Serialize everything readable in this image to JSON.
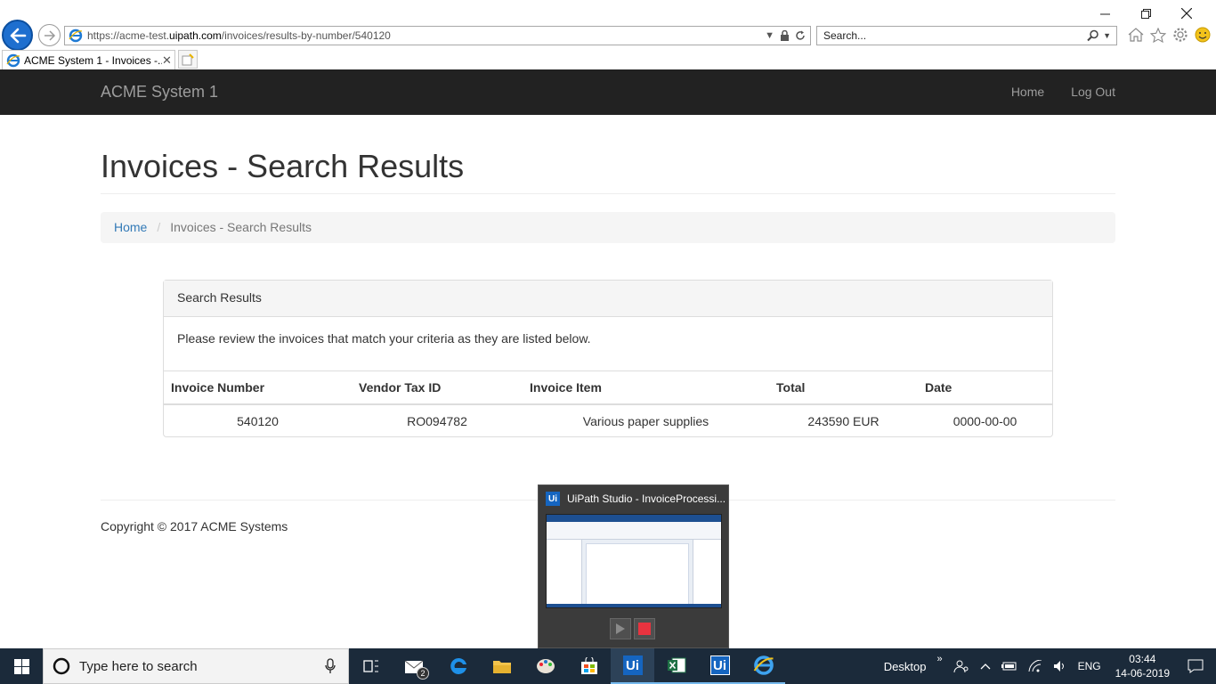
{
  "browser": {
    "url_prefix": "https://acme-test.",
    "url_host": "uipath.com",
    "url_path": "/invoices/results-by-number/540120",
    "search_placeholder": "Search...",
    "tab_title": "ACME System 1 - Invoices -...",
    "tab_close": "✕"
  },
  "navbar": {
    "brand": "ACME System 1",
    "links": [
      "Home",
      "Log Out"
    ]
  },
  "page": {
    "title": "Invoices - Search Results",
    "breadcrumb": {
      "home": "Home",
      "separator": "/",
      "current": "Invoices - Search Results"
    },
    "panel": {
      "heading": "Search Results",
      "body": "Please review the invoices that match your criteria as they are listed below.",
      "columns": [
        "Invoice Number",
        "Vendor Tax ID",
        "Invoice Item",
        "Total",
        "Date"
      ],
      "rows": [
        [
          "540120",
          "RO094782",
          "Various paper supplies",
          "243590 EUR",
          "0000-00-00"
        ]
      ]
    },
    "footer": "Copyright © 2017 ACME Systems"
  },
  "preview": {
    "title": "UiPath Studio - InvoiceProcessi...",
    "logo": "Ui"
  },
  "taskbar": {
    "search_placeholder": "Type here to search",
    "mail_badge": "2",
    "uipath_label": "Ui",
    "desktop_label": "Desktop",
    "language": "ENG",
    "time": "03:44",
    "date": "14-06-2019"
  },
  "colors": {
    "navbar_bg": "#222222",
    "link": "#337ab7",
    "taskbar_bg": "#1b2a3a",
    "ie_blue": "#1e6fcf"
  }
}
